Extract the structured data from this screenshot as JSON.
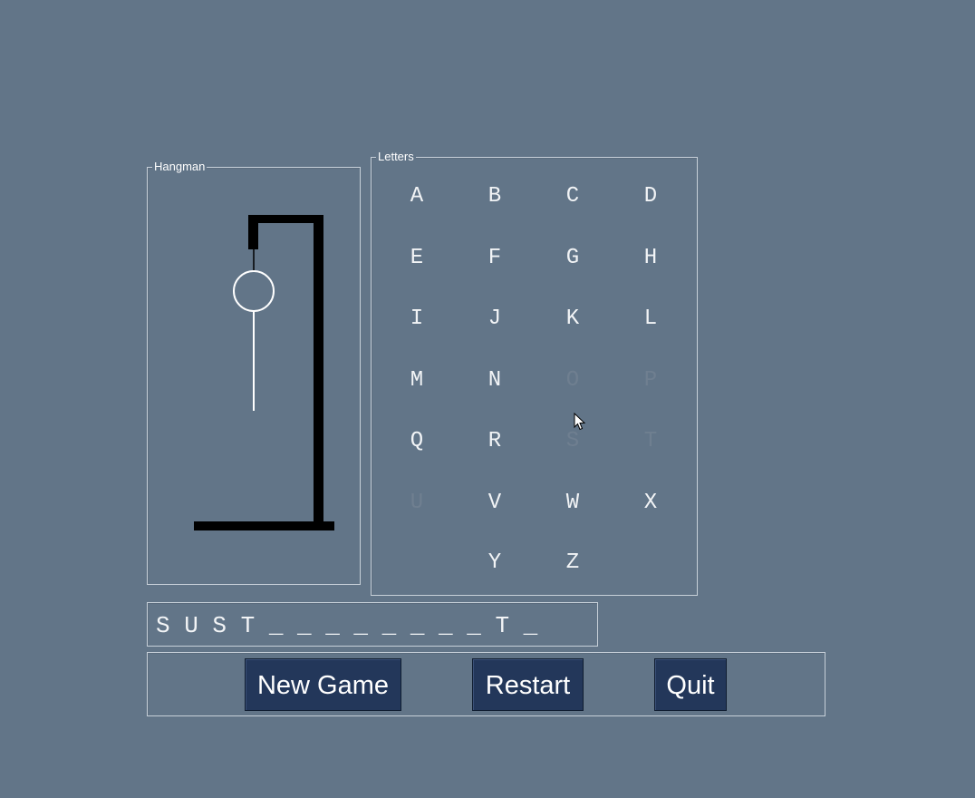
{
  "hangman_panel": {
    "title": "Hangman",
    "wrong_guesses_drawn": [
      "head",
      "body"
    ]
  },
  "letters_panel": {
    "title": "Letters",
    "letters": [
      {
        "char": "A",
        "used": false
      },
      {
        "char": "B",
        "used": false
      },
      {
        "char": "C",
        "used": false
      },
      {
        "char": "D",
        "used": false
      },
      {
        "char": "E",
        "used": false
      },
      {
        "char": "F",
        "used": false
      },
      {
        "char": "G",
        "used": false
      },
      {
        "char": "H",
        "used": false
      },
      {
        "char": "I",
        "used": false
      },
      {
        "char": "J",
        "used": false
      },
      {
        "char": "K",
        "used": false
      },
      {
        "char": "L",
        "used": false
      },
      {
        "char": "M",
        "used": false
      },
      {
        "char": "N",
        "used": false
      },
      {
        "char": "O",
        "used": true
      },
      {
        "char": "P",
        "used": true
      },
      {
        "char": "Q",
        "used": false
      },
      {
        "char": "R",
        "used": false
      },
      {
        "char": "S",
        "used": true
      },
      {
        "char": "T",
        "used": true
      },
      {
        "char": "U",
        "used": true
      },
      {
        "char": "V",
        "used": false
      },
      {
        "char": "W",
        "used": false
      },
      {
        "char": "X",
        "used": false
      },
      {
        "char": "Y",
        "used": false
      },
      {
        "char": "Z",
        "used": false
      }
    ]
  },
  "word": {
    "display": "S U S T _ _ _ _ _ _ _ _ T _"
  },
  "buttons": {
    "new_game": "New Game",
    "restart": "Restart",
    "quit": "Quit"
  },
  "colors": {
    "background": "#627588",
    "button": "#23375a",
    "letter_available": "#f2f4f6",
    "letter_used": "#6f7f90"
  }
}
